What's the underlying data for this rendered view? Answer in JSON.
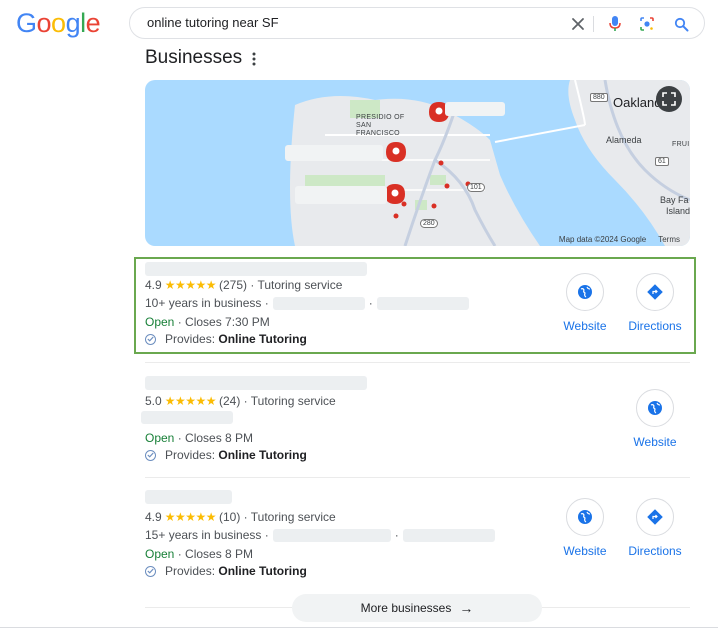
{
  "header": {
    "logo_letters": [
      "G",
      "o",
      "o",
      "g",
      "l",
      "e"
    ],
    "logo_colors": [
      "#4285F4",
      "#EA4335",
      "#FBBC05",
      "#4285F4",
      "#34A853",
      "#EA4335"
    ],
    "query": "online tutoring near SF",
    "icons": [
      "clear-icon",
      "mic-icon",
      "lens-icon",
      "search-icon"
    ]
  },
  "section": {
    "title": "Businesses"
  },
  "map": {
    "city_labels": [
      "Oakland",
      "Alameda"
    ],
    "area_labels": [
      "PRESIDIO OF SAN FRANCISCO",
      "FRUI"
    ],
    "bay_label": [
      "Bay Fa",
      "Island"
    ],
    "highway_labels": [
      "880",
      "61",
      "101",
      "280"
    ],
    "attribution": "Map data ©2024 Google",
    "terms": "Terms"
  },
  "results": [
    {
      "rating": "4.9",
      "stars": "★★★★★",
      "reviews": "(275)",
      "category": "· Tutoring service",
      "years": "10+ years in business ·",
      "dot_sep": "·",
      "status_open": "Open",
      "status_hours": "· Closes 7:30 PM",
      "provides_label": "Provides:",
      "provides_value": "Online Tutoring",
      "website_label": "Website",
      "directions_label": "Directions"
    },
    {
      "rating": "5.0",
      "stars": "★★★★★",
      "reviews": "(24)",
      "category": "· Tutoring service",
      "status_open": "Open",
      "status_hours": "· Closes 8 PM",
      "provides_label": "Provides:",
      "provides_value": "Online Tutoring",
      "website_label": "Website"
    },
    {
      "rating": "4.9",
      "stars": "★★★★★",
      "reviews": "(10)",
      "category": "· Tutoring service",
      "years": "15+ years in business ·",
      "dot_sep": "·",
      "status_open": "Open",
      "status_hours": "· Closes 8 PM",
      "provides_label": "Provides:",
      "provides_value": "Online Tutoring",
      "website_label": "Website",
      "directions_label": "Directions"
    }
  ],
  "more_button": {
    "label": "More businesses",
    "arrow": "→"
  }
}
